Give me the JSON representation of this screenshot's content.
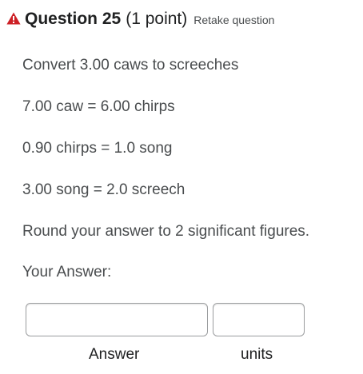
{
  "header": {
    "warning_icon": "warning-triangle-icon",
    "title": "Question 25",
    "points": "(1 point)",
    "retake_label": "Retake question"
  },
  "body": {
    "prompt": "Convert 3.00 caws to screeches",
    "equivalences": [
      "7.00 caw = 6.00 chirps",
      "0.90 chirps = 1.0 song",
      "3.00 song = 2.0 screech"
    ],
    "instruction": "Round your answer to 2 significant figures.",
    "answer_heading": "Your Answer:"
  },
  "inputs": {
    "answer_value": "",
    "units_value": "",
    "answer_label": "Answer",
    "units_label": "units"
  },
  "colors": {
    "warning": "#cd2026",
    "text": "#494c4e",
    "title": "#202122",
    "input_border": "#9a9c9e"
  }
}
